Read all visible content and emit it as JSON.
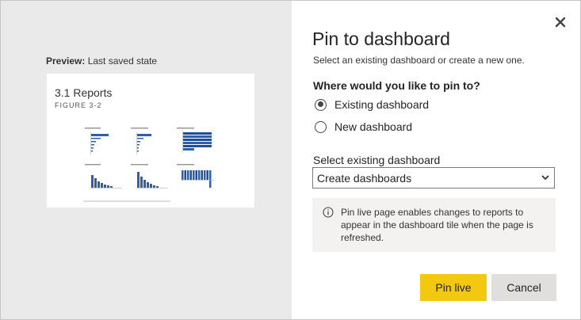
{
  "preview": {
    "label_bold": "Preview:",
    "label_text": "Last saved state",
    "thumb_title": "3.1 Reports",
    "thumb_subtitle": "FIGURE 3-2"
  },
  "dialog": {
    "title": "Pin to dashboard",
    "subtitle": "Select an existing dashboard or create a new one.",
    "question": "Where would you like to pin to?",
    "options": [
      {
        "label": "Existing dashboard",
        "checked": true
      },
      {
        "label": "New dashboard",
        "checked": false
      }
    ],
    "select_label": "Select existing dashboard",
    "select_value": "Create dashboards",
    "info_text": "Pin live page enables changes to reports to appear in the dashboard tile when the page is refreshed.",
    "primary_button": "Pin live",
    "secondary_button": "Cancel"
  },
  "colors": {
    "accent": "#f2c811",
    "secondary_button": "#e1dfdd",
    "preview_bg": "#eaeaea",
    "chart_blue": "#2f5fa8"
  },
  "icons": {
    "close": "close-icon",
    "info": "info-icon",
    "chevron": "chevron-down-icon"
  }
}
